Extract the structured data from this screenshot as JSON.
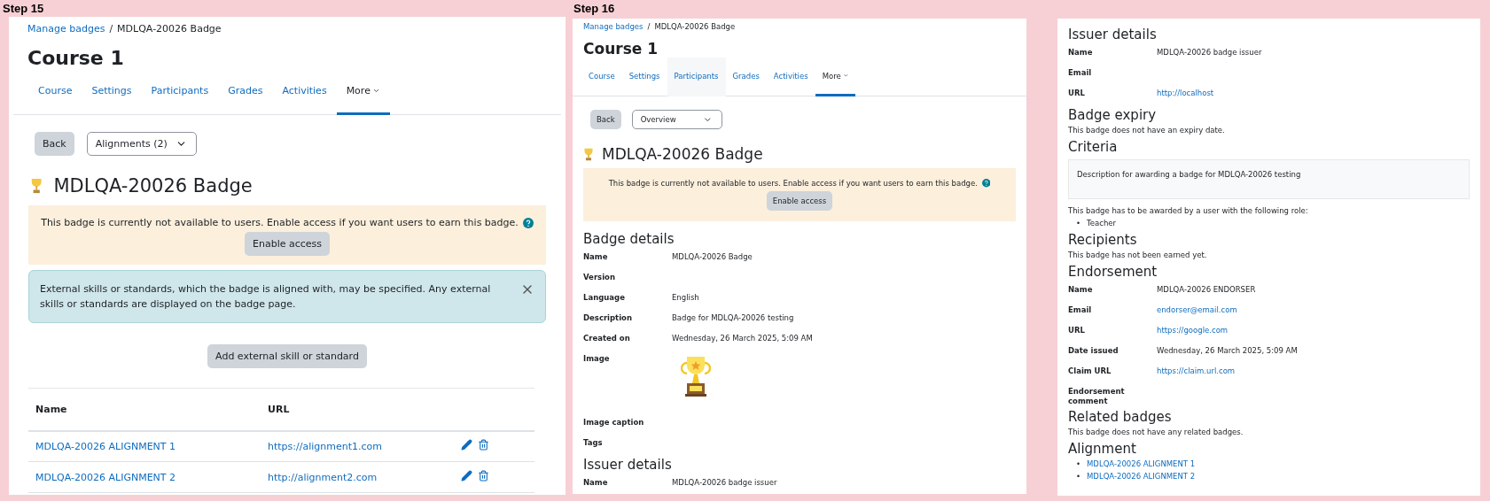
{
  "step_15": {
    "label": "Step 15",
    "breadcrumb": {
      "link": "Manage badges",
      "separator": "/",
      "current": "MDLQA-20026 Badge"
    },
    "course_title": "Course 1",
    "tabs": [
      {
        "label": "Course",
        "selected": false,
        "hovered": false
      },
      {
        "label": "Settings",
        "selected": false,
        "hovered": false
      },
      {
        "label": "Participants",
        "selected": false,
        "hovered": false
      },
      {
        "label": "Grades",
        "selected": false,
        "hovered": false
      },
      {
        "label": "Activities",
        "selected": false,
        "hovered": false
      },
      {
        "label": "More",
        "selected": true,
        "hovered": false
      }
    ],
    "back_button": "Back",
    "select": {
      "value": "Alignments (2)"
    },
    "badge_title": "MDLQA-20026 Badge",
    "notice": {
      "text": "This badge is currently not available to users. Enable access if you want users to earn this badge.",
      "button": "Enable access"
    },
    "info_alert": {
      "text": "External skills or standards, which the badge is aligned with, may be specified. Any external skills or standards are displayed on the badge page."
    },
    "add_button": "Add external skill or standard",
    "table": {
      "columns": [
        "Name",
        "URL"
      ],
      "rows": [
        {
          "name": "MDLQA-20026 ALIGNMENT 1",
          "url": "https://alignment1.com"
        },
        {
          "name": "MDLQA-20026 ALIGNMENT 2",
          "url": "http://alignment2.com"
        }
      ]
    }
  },
  "step_16": {
    "label": "Step 16",
    "top_view": {
      "breadcrumb": {
        "link": "Manage badges",
        "separator": "/",
        "current": "MDLQA-20026 Badge"
      },
      "course_title": "Course 1",
      "tabs": [
        {
          "label": "Course",
          "selected": false,
          "hovered": false
        },
        {
          "label": "Settings",
          "selected": false,
          "hovered": false
        },
        {
          "label": "Participants",
          "selected": false,
          "hovered": true
        },
        {
          "label": "Grades",
          "selected": false,
          "hovered": false
        },
        {
          "label": "Activities",
          "selected": false,
          "hovered": false
        },
        {
          "label": "More",
          "selected": true,
          "hovered": false
        }
      ],
      "back_button": "Back",
      "select": {
        "value": "Overview"
      },
      "badge_title": "MDLQA-20026 Badge",
      "notice": {
        "text": "This badge is currently not available to users. Enable access if you want users to earn this badge.",
        "button": "Enable access"
      },
      "sections": [
        {
          "heading": "Badge details",
          "blocks": [
            {
              "kind": "field",
              "label": "Name",
              "value": "MDLQA-20026 Badge"
            },
            {
              "kind": "field",
              "label": "Version"
            },
            {
              "kind": "field",
              "label": "Language",
              "value": "English"
            },
            {
              "kind": "field",
              "label": "Description",
              "value": "Badge for MDLQA-20026 testing"
            },
            {
              "kind": "field",
              "label": "Created on",
              "value": "Wednesday, 26 March 2025, 5:09 AM"
            },
            {
              "kind": "image",
              "label": "Image"
            },
            {
              "kind": "field",
              "label": "Image caption"
            },
            {
              "kind": "field",
              "label": "Tags"
            }
          ]
        },
        {
          "heading": "Issuer details",
          "blocks": [
            {
              "kind": "field",
              "label": "Name",
              "value": "MDLQA-20026 badge issuer"
            }
          ]
        }
      ]
    },
    "bottom_view": {
      "sections": [
        {
          "heading": "Issuer details",
          "blocks": [
            {
              "kind": "field",
              "label": "Name",
              "value": "MDLQA-20026 badge issuer"
            },
            {
              "kind": "field",
              "label": "Email"
            },
            {
              "kind": "link",
              "label": "URL",
              "value": "http://localhost"
            }
          ]
        },
        {
          "heading": "Badge expiry",
          "blocks": [
            {
              "kind": "text",
              "text": "This badge does not have an expiry date."
            }
          ]
        },
        {
          "heading": "Criteria",
          "blocks": [
            {
              "kind": "panel",
              "text": "Description for awarding a badge for MDLQA-20026 testing"
            },
            {
              "kind": "text",
              "text": "This badge has to be awarded by a user with the following role:"
            },
            {
              "kind": "bullets",
              "marker": "•",
              "items": [
                "Teacher"
              ]
            }
          ]
        },
        {
          "heading": "Recipients",
          "blocks": [
            {
              "kind": "text",
              "text": "This badge has not been earned yet."
            }
          ]
        },
        {
          "heading": "Endorsement",
          "blocks": [
            {
              "kind": "field",
              "label": "Name",
              "value": "MDLQA-20026 ENDORSER"
            },
            {
              "kind": "link",
              "label": "Email",
              "value": "endorser@email.com"
            },
            {
              "kind": "link",
              "label": "URL",
              "value": "https://google.com"
            },
            {
              "kind": "field",
              "label": "Date issued",
              "value": "Wednesday, 26 March 2025, 5:09 AM"
            },
            {
              "kind": "link",
              "label": "Claim URL",
              "value": "https://claim.url.com"
            },
            {
              "kind": "field",
              "label": "Endorsement comment"
            }
          ]
        },
        {
          "heading": "Related badges",
          "blocks": [
            {
              "kind": "text",
              "text": "This badge does not have any related badges."
            }
          ]
        },
        {
          "heading": "Alignment",
          "blocks": [
            {
              "kind": "link_bullets",
              "marker": "•",
              "items": [
                "MDLQA-20026 ALIGNMENT 1",
                "MDLQA-20026 ALIGNMENT 2"
              ]
            }
          ]
        }
      ]
    }
  }
}
